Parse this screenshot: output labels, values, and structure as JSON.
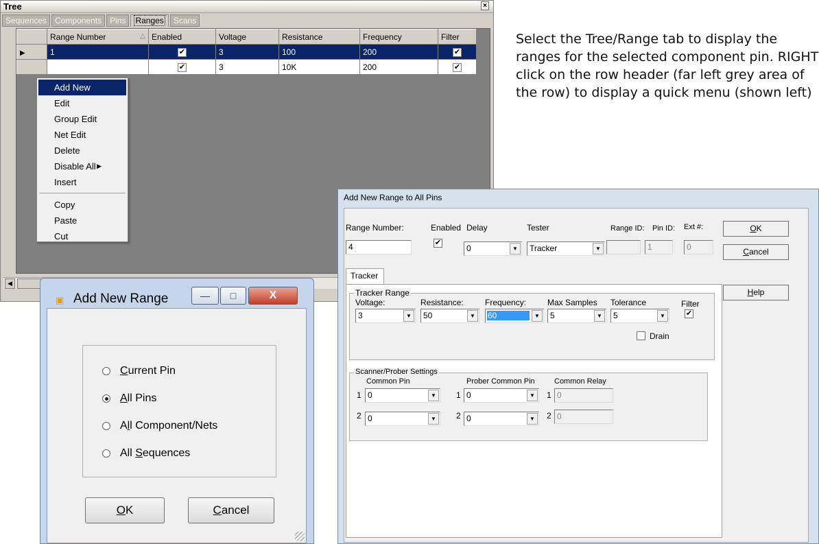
{
  "tree_window": {
    "title": "Tree",
    "close_icon": "close-icon",
    "tabs": [
      {
        "label": "Sequences",
        "active": false
      },
      {
        "label": "Components",
        "active": false
      },
      {
        "label": "Pins",
        "active": false
      },
      {
        "label": "Ranges",
        "active": true
      },
      {
        "label": "Scans",
        "active": false
      }
    ],
    "columns": [
      "Range Number",
      "Enabled",
      "Voltage",
      "Resistance",
      "Frequency",
      "Filter"
    ],
    "rows": [
      {
        "range_number": "1",
        "enabled": true,
        "voltage": "3",
        "resistance": "100",
        "frequency": "200",
        "filter": true,
        "selected": true
      },
      {
        "range_number": "",
        "enabled": true,
        "voltage": "3",
        "resistance": "10K",
        "frequency": "200",
        "filter": true,
        "selected": false
      }
    ],
    "current_row_marker": "▶",
    "sort_glyph": "△"
  },
  "context_menu": {
    "items": [
      "Add New",
      "Edit",
      "Group Edit",
      "Net Edit",
      "Delete",
      "Disable All",
      "Insert"
    ],
    "items_2": [
      "Copy",
      "Paste",
      "Cut"
    ],
    "submenu_arrow": "▶"
  },
  "add_new_range_dialog": {
    "title": "Add New Range",
    "minimize": "—",
    "maximize": "□",
    "close": "X",
    "options": [
      {
        "pre": "",
        "ul": "C",
        "post": "urrent Pin",
        "selected": false
      },
      {
        "pre": "",
        "ul": "A",
        "post": "ll Pins",
        "selected": true
      },
      {
        "pre": "A",
        "ul": "l",
        "post": "l Component/Nets",
        "selected": false
      },
      {
        "pre": "All ",
        "ul": "S",
        "post": "equences",
        "selected": false
      }
    ],
    "ok_ul": "O",
    "ok_rest": "K",
    "cancel_ul": "C",
    "cancel_rest": "ancel"
  },
  "all_pins_dialog": {
    "title": "Add New Range to All Pins",
    "range_number_label": "Range Number:",
    "range_number_value": "4",
    "enabled_label": "Enabled",
    "delay_label": "Delay",
    "delay_value": "0",
    "tester_label": "Tester",
    "tester_value": "Tracker",
    "range_id_label": "Range ID:",
    "range_id_value": "",
    "pin_id_label": "Pin ID:",
    "pin_id_value": "1",
    "ext_label": "Ext #:",
    "ext_value": "0",
    "ok_ul": "O",
    "ok_rest": "K",
    "cancel_ul": "C",
    "cancel_rest": "ancel",
    "help_ul": "H",
    "help_rest": "elp",
    "tab_label": "Tracker",
    "tracker_range": {
      "legend": "Tracker Range",
      "voltage_label": "Voltage:",
      "voltage_value": "3",
      "resistance_label": "Resistance:",
      "resistance_value": "50",
      "frequency_label": "Frequency:",
      "frequency_value": "60",
      "max_samples_label": "Max Samples",
      "max_samples_value": "5",
      "tolerance_label": "Tolerance",
      "tolerance_value": "5",
      "filter_label": "Filter",
      "drain_label": "Drain"
    },
    "scanner": {
      "legend": "Scanner/Prober Settings",
      "common_pin_label": "Common Pin",
      "prober_common_pin_label": "Prober Common Pin",
      "common_relay_label": "Common Relay",
      "row1": {
        "num": "1",
        "common_pin": "0",
        "prober_common_pin": "0",
        "common_relay": "0"
      },
      "row2": {
        "num": "2",
        "common_pin": "0",
        "prober_common_pin": "0",
        "common_relay": "0"
      }
    }
  },
  "instructions": "Select the Tree/Range tab to display the ranges for the selected component pin. RIGHT click on the row header (far left grey area of the row) to display a quick menu (shown left)",
  "icons": {
    "check": "✔",
    "dropdown": "▼",
    "scroll_left": "◀",
    "app_icon": "▣"
  }
}
